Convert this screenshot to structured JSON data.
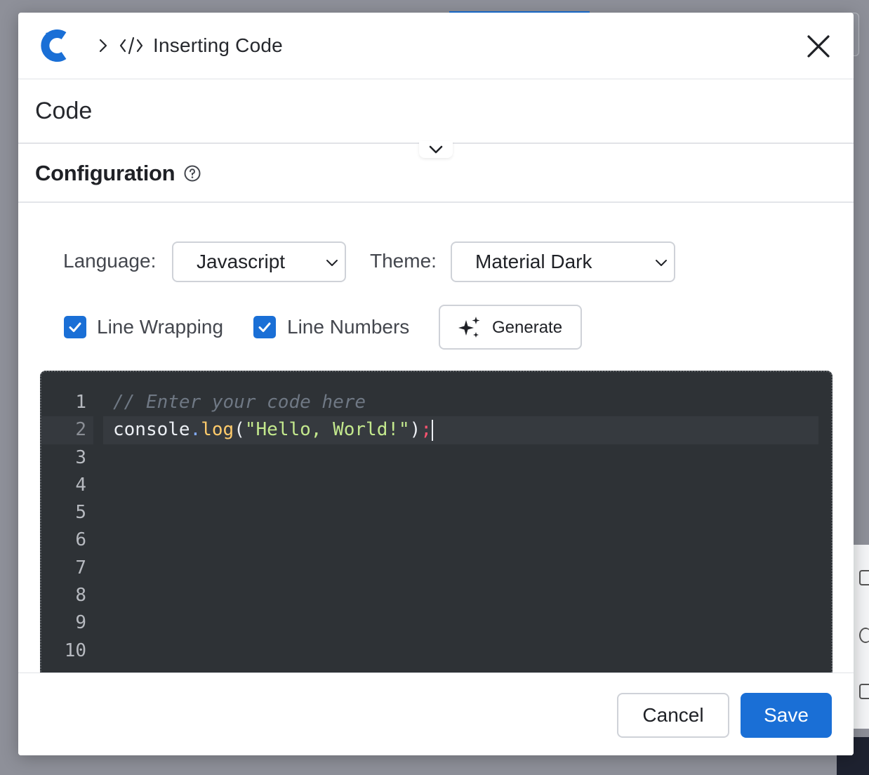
{
  "header": {
    "title": "Inserting Code",
    "close_label": "Close"
  },
  "sections": {
    "code_title": "Code",
    "config_title": "Configuration"
  },
  "config": {
    "language_label": "Language:",
    "language_value": "Javascript",
    "theme_label": "Theme:",
    "theme_value": "Material Dark",
    "line_wrapping_label": "Line Wrapping",
    "line_wrapping_checked": true,
    "line_numbers_label": "Line Numbers",
    "line_numbers_checked": true,
    "generate_label": "Generate"
  },
  "editor": {
    "line_numbers": [
      "1",
      "2",
      "3",
      "4",
      "5",
      "6",
      "7",
      "8",
      "9",
      "10"
    ],
    "active_line": 2,
    "line1": "// Enter your code here",
    "line2": {
      "obj": "console",
      "dot": ".",
      "fn": "log",
      "open": "(",
      "str": "\"Hello, World!\"",
      "close": ")",
      "semi": ";"
    }
  },
  "footer": {
    "cancel_label": "Cancel",
    "save_label": "Save"
  },
  "colors": {
    "accent": "#1a6fd6",
    "editor_bg": "#2e3236"
  }
}
